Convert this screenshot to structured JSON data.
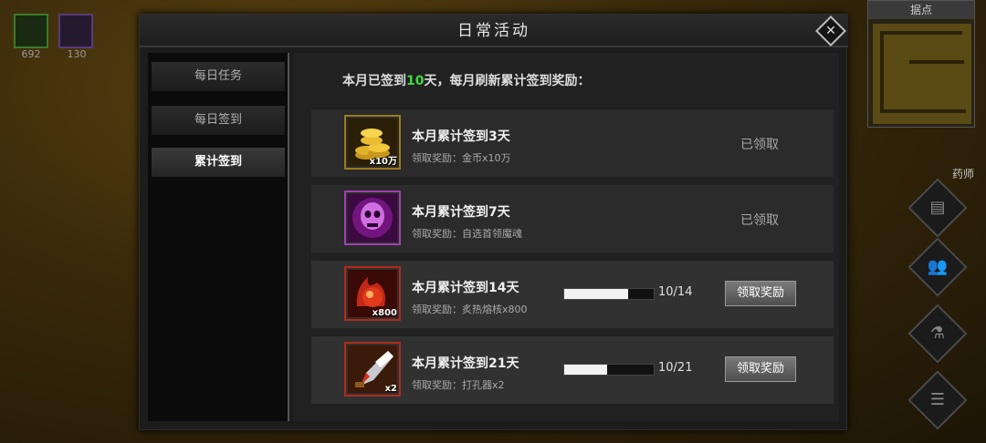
{
  "hud": {
    "slot1_count": "692",
    "slot2_count": "130",
    "minimap_title": "据点",
    "side_label": "药师"
  },
  "dialog": {
    "title": "日常活动",
    "close_glyph": "✕"
  },
  "tabs": [
    {
      "label": "每日任务",
      "active": false
    },
    {
      "label": "每日签到",
      "active": false
    },
    {
      "label": "累计签到",
      "active": true
    }
  ],
  "summary": {
    "prefix": "本月已签到",
    "days": "10",
    "suffix": "天，每月刷新累计签到奖励："
  },
  "rewards": [
    {
      "title": "本月累计签到3天",
      "reward": "领取奖励：金币x10万",
      "qty": "x10万",
      "icon": "gold-coins-icon",
      "status": "已领取",
      "claimed": true
    },
    {
      "title": "本月累计签到7天",
      "reward": "领取奖励：自选首领魔魂",
      "qty": "",
      "icon": "boss-soul-icon",
      "status": "已领取",
      "claimed": true
    },
    {
      "title": "本月累计签到14天",
      "reward": "领取奖励：炙热熔核x800",
      "qty": "x800",
      "icon": "molten-core-icon",
      "progress_text": "10/14",
      "progress": 0.714,
      "button": "领取奖励",
      "claimed": false
    },
    {
      "title": "本月累计签到21天",
      "reward": "领取奖励：打孔器x2",
      "qty": "x2",
      "icon": "socket-punch-icon",
      "progress_text": "10/21",
      "progress": 0.476,
      "button": "领取奖励",
      "claimed": false
    }
  ],
  "colors": {
    "highlight": "#3fd93f",
    "gold_border": "#9a7a1a",
    "purple_border": "#a040b0",
    "red_border": "#b02a1a"
  }
}
